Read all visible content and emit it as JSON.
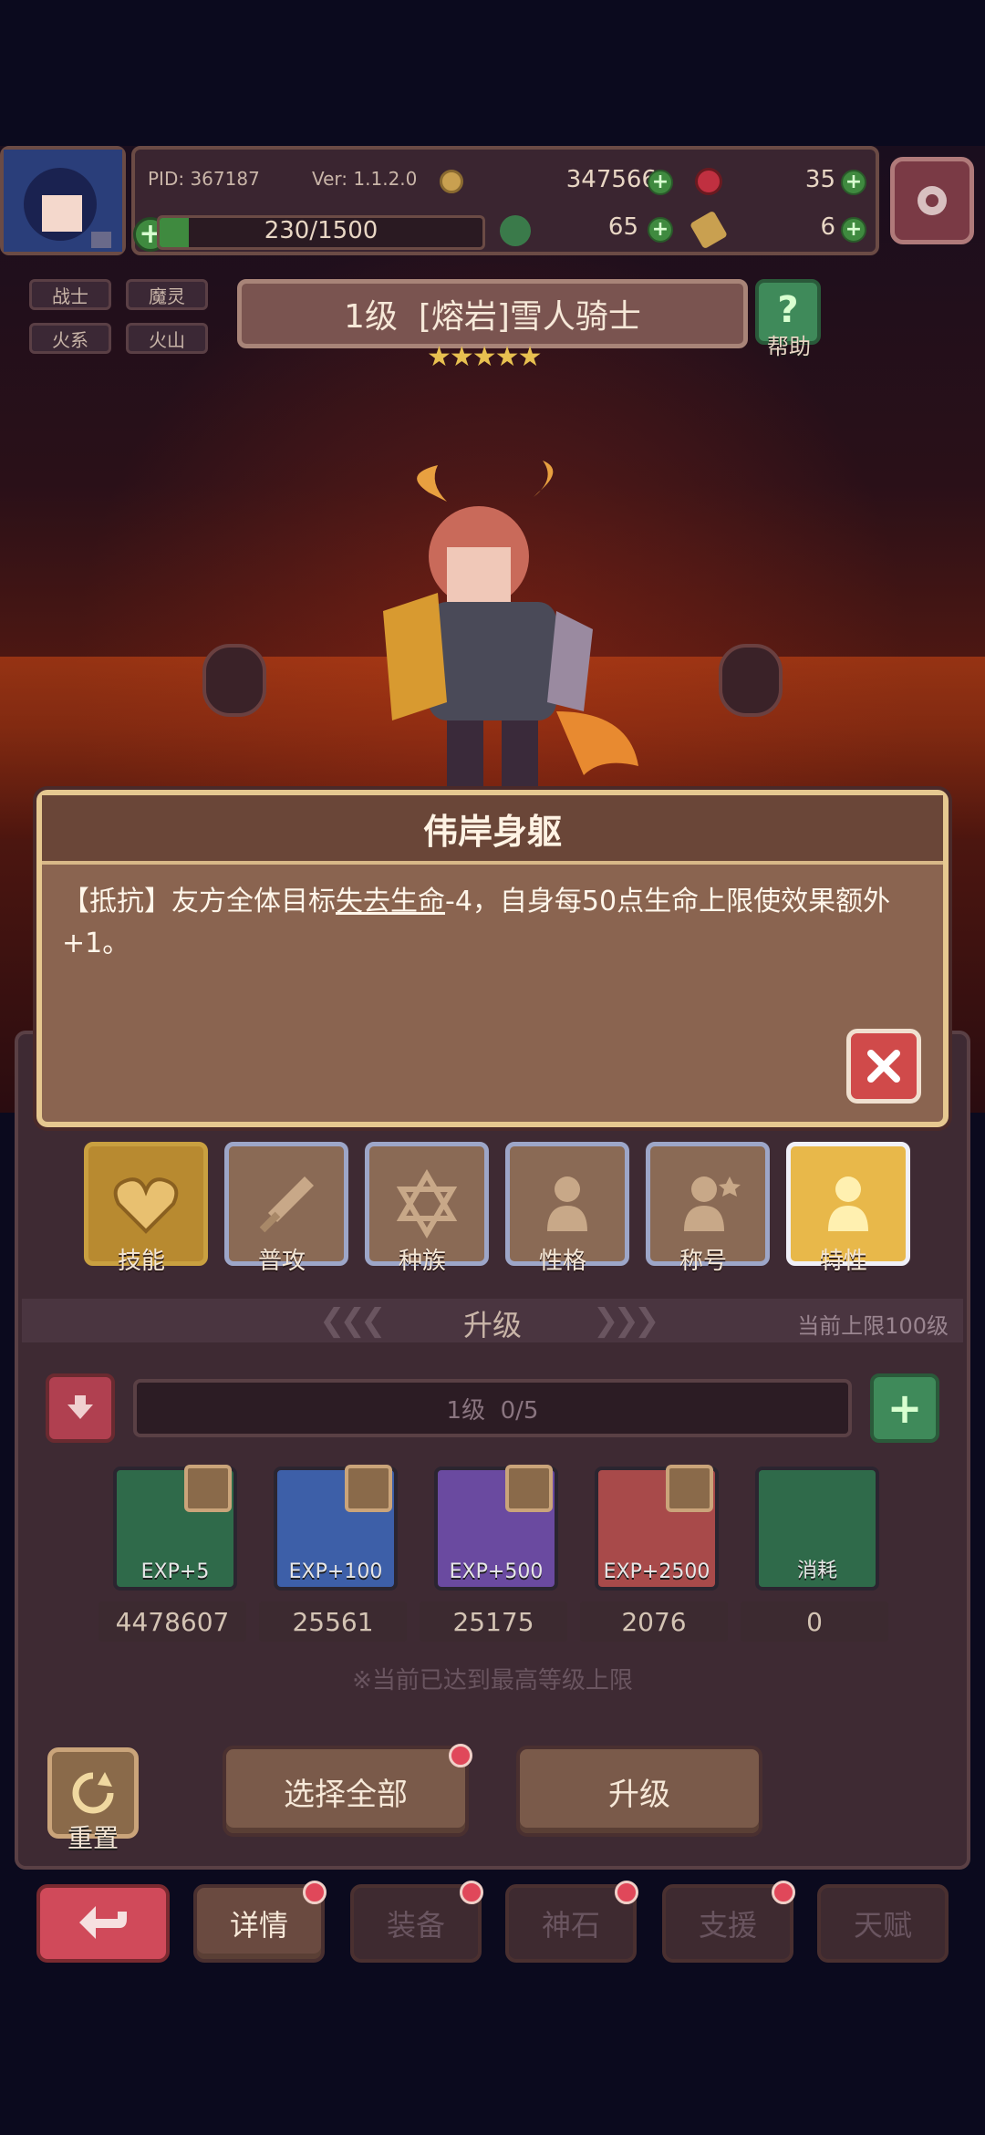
{
  "header": {
    "pid": "PID: 367187",
    "version": "Ver: 1.1.2.0",
    "gold": "347566",
    "gems": "35",
    "exp_bar": "230/1500",
    "clover": "65",
    "keys": "6"
  },
  "tags": [
    "战士",
    "魔灵",
    "火系",
    "火山"
  ],
  "character": {
    "title": "1级  [熔岩]雪人骑士",
    "stars": 5,
    "help_label": "帮助"
  },
  "popup": {
    "title": "伟岸身躯",
    "desc_prefix": "【抵抗】友方全体目标",
    "desc_link": "失去生命",
    "desc_suffix": "-4，自身每50点生命上限使效果额外+1。"
  },
  "tabs": [
    {
      "label": "技能",
      "icon": "heart-icon"
    },
    {
      "label": "普攻",
      "icon": "sword-icon"
    },
    {
      "label": "种族",
      "icon": "star-of-david-icon"
    },
    {
      "label": "性格",
      "icon": "person-icon"
    },
    {
      "label": "称号",
      "icon": "person-star-icon"
    },
    {
      "label": "特性",
      "icon": "person-icon"
    }
  ],
  "upgrade": {
    "section_title": "升级",
    "limit": "当前上限100级",
    "level_bar": "1级  0/5",
    "materials": [
      {
        "label": "EXP+5",
        "count": "4478607",
        "color": "#2f6a4a"
      },
      {
        "label": "EXP+100",
        "count": "25561",
        "color": "#3d5fa8"
      },
      {
        "label": "EXP+500",
        "count": "25175",
        "color": "#6a4aa0"
      },
      {
        "label": "EXP+2500",
        "count": "2076",
        "color": "#a84a4a"
      },
      {
        "label": "消耗",
        "count": "0",
        "color": "#2f6a4a"
      }
    ],
    "notice": "※当前已达到最高等级上限",
    "reset_label": "重置",
    "select_all_label": "选择全部",
    "upgrade_label": "升级"
  },
  "bottom_nav": [
    "详情",
    "装备",
    "神石",
    "支援",
    "天赋"
  ],
  "colors": {
    "accent_green": "#3f8a3f",
    "popup_bg": "#8a6450",
    "close_red": "#d04a4a",
    "active_tab": "#e8b84a"
  }
}
